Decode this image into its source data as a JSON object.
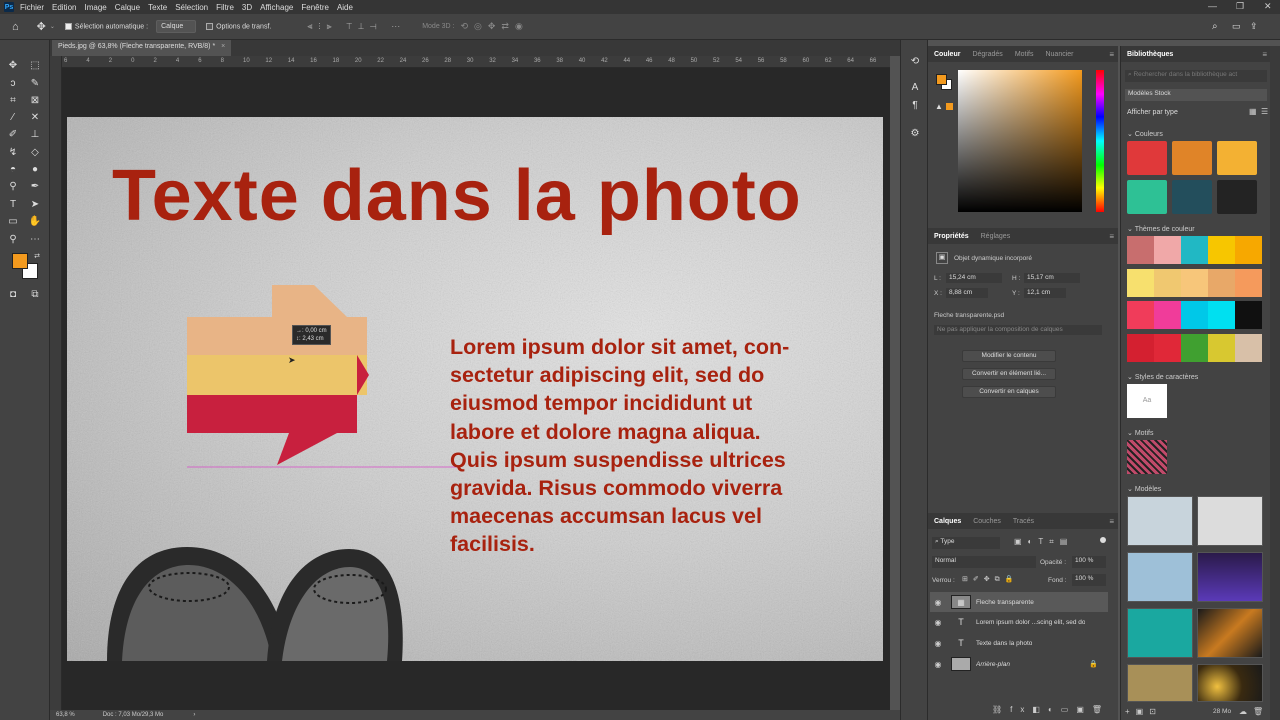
{
  "menubar": {
    "logo": "Ps",
    "items": [
      "Fichier",
      "Edition",
      "Image",
      "Calque",
      "Texte",
      "Sélection",
      "Filtre",
      "3D",
      "Affichage",
      "Fenêtre",
      "Aide"
    ]
  },
  "options": {
    "auto_select_label": "Sélection automatique :",
    "auto_select_value": "Calque",
    "transform_label": "Options de transf.",
    "mode3d_label": "Mode 3D :"
  },
  "document": {
    "tab_title": "Pieds.jpg @ 63,8% (Fleche transparente, RVB/8) *",
    "zoom": "63,8 %",
    "doc_info": "Doc : 7,03 Mo/29,3 Mo"
  },
  "ruler": {
    "h_ticks": [
      "6",
      "4",
      "2",
      "0",
      "2",
      "4",
      "6",
      "8",
      "10",
      "12",
      "14",
      "16",
      "18",
      "20",
      "22",
      "24",
      "26",
      "28",
      "30",
      "32",
      "34",
      "36",
      "38",
      "40",
      "42",
      "44",
      "46",
      "48",
      "50",
      "52",
      "54",
      "56",
      "58",
      "60",
      "62",
      "64",
      "66"
    ]
  },
  "canvas": {
    "title": "Texte dans la photo",
    "body": "Lorem ipsum dolor sit amet, con-\nsectetur adipiscing elit, sed do\neiusmod tempor incididunt ut\nlabore et dolore magna aliqua.\nQuis ipsum suspendisse ultrices\ngravida. Risus commodo viverra\nmaecenas accumsan lacus vel\nfacilisis.",
    "tooltip_dx": "→: 0,00 cm",
    "tooltip_dy": "↕: 2,43 cm",
    "arrow_colors": [
      "#e8b486",
      "#ecc56a",
      "#c8203e"
    ],
    "text_color": "#a8220f"
  },
  "color_panel": {
    "tabs": [
      "Couleur",
      "Dégradés",
      "Motifs",
      "Nuancier"
    ],
    "fg_color": "#f39a1e",
    "bg_color": "#ffffff"
  },
  "properties": {
    "tabs": [
      "Propriétés",
      "Réglages"
    ],
    "kind": "Objet dynamique incorporé",
    "w_label": "L :",
    "w_value": "15,24 cm",
    "h_label": "H :",
    "h_value": "15,17 cm",
    "x_label": "X :",
    "x_value": "8,88 cm",
    "y_label": "Y :",
    "y_value": "12,1 cm",
    "source": "Fleche transparente.psd",
    "comp_placeholder": "Ne pas appliquer la composition de calques",
    "buttons": [
      "Modifier le contenu",
      "Convertir en élément lié...",
      "Convertir en calques"
    ]
  },
  "layers": {
    "tabs": [
      "Calques",
      "Couches",
      "Tracés"
    ],
    "filter": "Type",
    "blend": "Normal",
    "opacity_label": "Opacité :",
    "opacity_value": "100 %",
    "lock_label": "Verrou :",
    "fill_label": "Fond :",
    "fill_value": "100 %",
    "items": [
      {
        "name": "Fleche transparente",
        "kind": "smart"
      },
      {
        "name": "Lorem ipsum dolor ...scing elit, sed do",
        "kind": "text"
      },
      {
        "name": "Texte dans la photo",
        "kind": "text"
      },
      {
        "name": "Arrière-plan",
        "kind": "image"
      }
    ]
  },
  "libraries": {
    "title": "Bibliothèques",
    "search_placeholder": "Rechercher dans la bibliothèque act",
    "library": "Modèles Stock",
    "view_by": "Afficher par type",
    "colors_label": "Couleurs",
    "colors": [
      "#e0393a",
      "#e08428",
      "#f3b133",
      "#2ec195",
      "#234e5c",
      "#232323"
    ],
    "themes_label": "Thèmes de couleur",
    "themes": [
      [
        "#c86e6e",
        "#f0a8a8",
        "#21b8c4",
        "#f7c600",
        "#f7a800"
      ],
      [
        "#f7e06e",
        "#f0c870",
        "#f7c67a",
        "#e8a868",
        "#f59a5c"
      ],
      [
        "#f03c5a",
        "#f03c9a",
        "#00c8e8",
        "#00e0f0",
        "#101010"
      ],
      [
        "#d42030",
        "#e02838",
        "#40a030",
        "#d8c830",
        "#d8c0a8"
      ]
    ],
    "char_styles_label": "Styles de caractères",
    "char_style_sample": "Aa",
    "patterns_label": "Motifs",
    "models_label": "Modèles",
    "size": "28 Mo"
  }
}
